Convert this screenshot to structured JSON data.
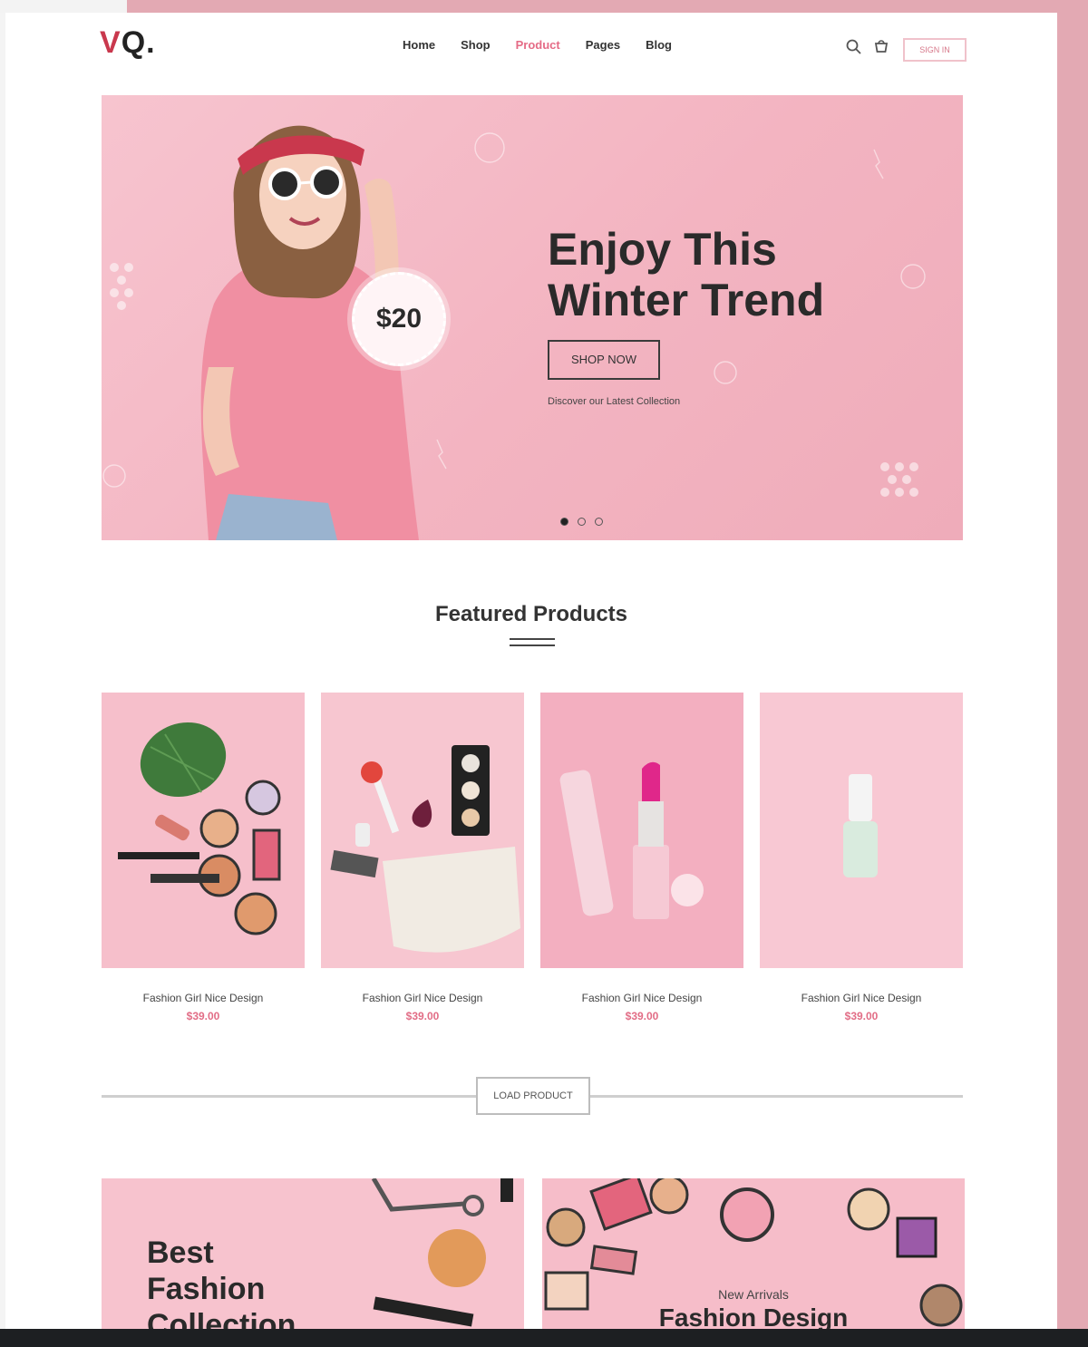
{
  "header": {
    "logo_v": "V",
    "logo_rest": "Q.",
    "nav": [
      "Home",
      "Shop",
      "Product",
      "Pages",
      "Blog"
    ],
    "active_nav": "Product",
    "signin_label": "SIGN IN"
  },
  "hero": {
    "title_line1": "Enjoy This",
    "title_line2": "Winter Trend",
    "cta": "SHOP NOW",
    "subtitle": "Discover our Latest Collection",
    "price": "$20",
    "slide_count": 3,
    "active_slide": 1
  },
  "featured": {
    "title": "Featured Products",
    "products": [
      {
        "name": "Fashion Girl Nice Design",
        "price": "$39.00"
      },
      {
        "name": "Fashion Girl Nice Design",
        "price": "$39.00"
      },
      {
        "name": "Fashion Girl Nice Design",
        "price": "$39.00"
      },
      {
        "name": "Fashion Girl Nice Design",
        "price": "$39.00"
      }
    ],
    "load_label": "LOAD PRODUCT"
  },
  "banners": {
    "left": {
      "line1": "Best",
      "line2": "Fashion",
      "line3": "Collection"
    },
    "right": {
      "subtitle": "New Arrivals",
      "title": "Fashion Design"
    }
  },
  "colors": {
    "accent": "#e56b86",
    "hero_bg": "#f3b4c1",
    "frame": "#e3a9b3"
  }
}
